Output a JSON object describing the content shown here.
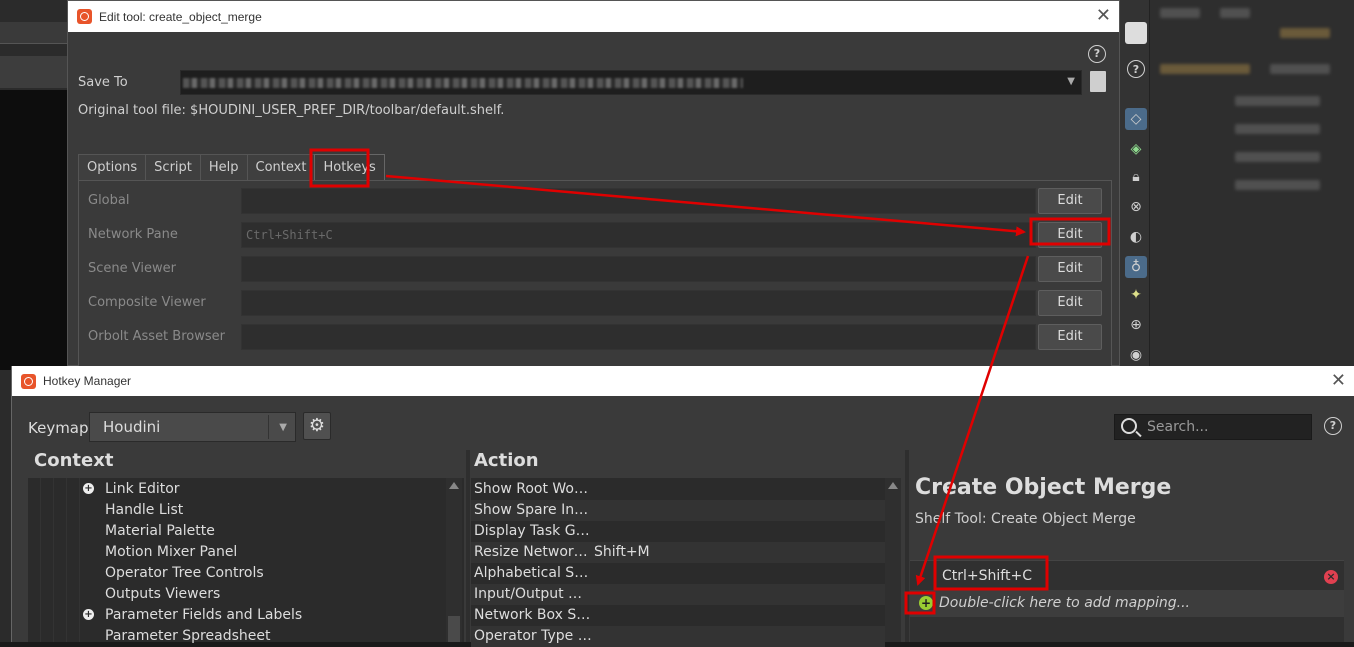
{
  "edit_dialog": {
    "title": "Edit tool: create_object_merge",
    "save_to_label": "Save To",
    "original_tool_file": "Original tool file: $HOUDINI_USER_PREF_DIR/toolbar/default.shelf.",
    "tabs": [
      "Options",
      "Script",
      "Help",
      "Context",
      "Hotkeys"
    ],
    "active_tab": "Hotkeys",
    "hotkey_rows": [
      {
        "label": "Global",
        "value": "",
        "button": "Edit"
      },
      {
        "label": "Network Pane",
        "value": "Ctrl+Shift+C",
        "button": "Edit"
      },
      {
        "label": "Scene Viewer",
        "value": "",
        "button": "Edit"
      },
      {
        "label": "Composite Viewer",
        "value": "",
        "button": "Edit"
      },
      {
        "label": "Orbolt Asset Browser",
        "value": "",
        "button": "Edit"
      }
    ]
  },
  "hotkey_manager": {
    "title": "Hotkey Manager",
    "keymap_label": "Keymap",
    "keymap_value": "Houdini",
    "search_placeholder": "Search...",
    "context_header": "Context",
    "action_header": "Action",
    "context_items": [
      {
        "label": "Link Editor",
        "expandable": true
      },
      {
        "label": "Handle List",
        "expandable": false
      },
      {
        "label": "Material Palette",
        "expandable": false
      },
      {
        "label": "Motion Mixer Panel",
        "expandable": false
      },
      {
        "label": "Operator Tree Controls",
        "expandable": false
      },
      {
        "label": "Outputs Viewers",
        "expandable": false
      },
      {
        "label": "Parameter Fields and Labels",
        "expandable": true
      },
      {
        "label": "Parameter Spreadsheet",
        "expandable": false
      }
    ],
    "actions": [
      {
        "name": "Show Root Wo…",
        "key": ""
      },
      {
        "name": "Show Spare In…",
        "key": ""
      },
      {
        "name": "Display Task G…",
        "key": ""
      },
      {
        "name": "Resize Networ…",
        "key": "Shift+M"
      },
      {
        "name": "Alphabetical S…",
        "key": ""
      },
      {
        "name": "Input/Output …",
        "key": ""
      },
      {
        "name": "Network Box S…",
        "key": ""
      },
      {
        "name": "Operator Type …",
        "key": ""
      }
    ],
    "detail": {
      "title": "Create Object Merge",
      "subtitle": "Shelf Tool: Create Object Merge",
      "mapping": "Ctrl+Shift+C",
      "add_mapping": "Double-click here to add mapping..."
    }
  },
  "colors": {
    "annotation": "#e00000",
    "houdini_logo": "#e8542a",
    "add_icon": "#9acd32",
    "delete_icon": "#e04050"
  },
  "icons": [
    "houdini-logo-icon",
    "close-icon",
    "help-icon",
    "dropdown-arrow-icon",
    "document-icon",
    "gear-icon",
    "search-icon",
    "plus-icon",
    "delete-icon",
    "add-icon"
  ]
}
